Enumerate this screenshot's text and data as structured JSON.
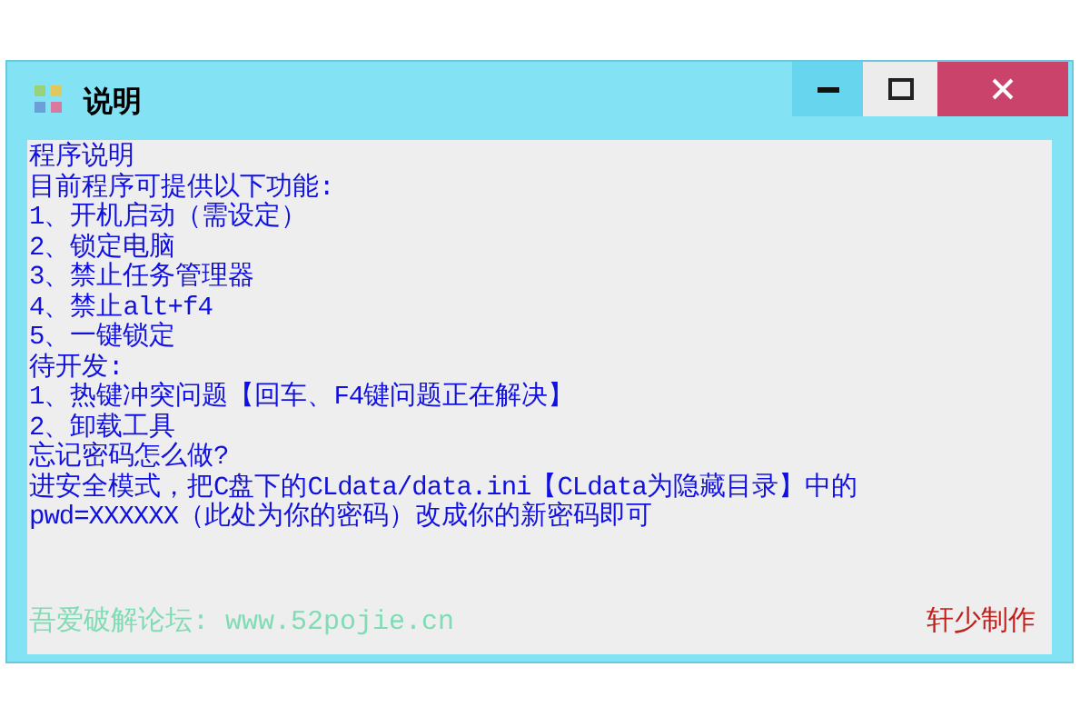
{
  "window": {
    "title": "说明"
  },
  "lines": [
    "程序说明",
    "目前程序可提供以下功能:",
    "1、开机启动（需设定）",
    "2、锁定电脑",
    "3、禁止任务管理器",
    "4、禁止alt+f4",
    "5、一键锁定",
    "待开发:",
    "1、热键冲突问题【回车、F4键问题正在解决】",
    "2、卸载工具",
    "忘记密码怎么做?",
    "进安全模式，把C盘下的CLdata/data.ini【CLdata为隐藏目录】中的",
    "pwd=XXXXXX（此处为你的密码）改成你的新密码即可"
  ],
  "footer": {
    "link": "吾爱破解论坛: www.52pojie.cn",
    "credit": "轩少制作"
  }
}
